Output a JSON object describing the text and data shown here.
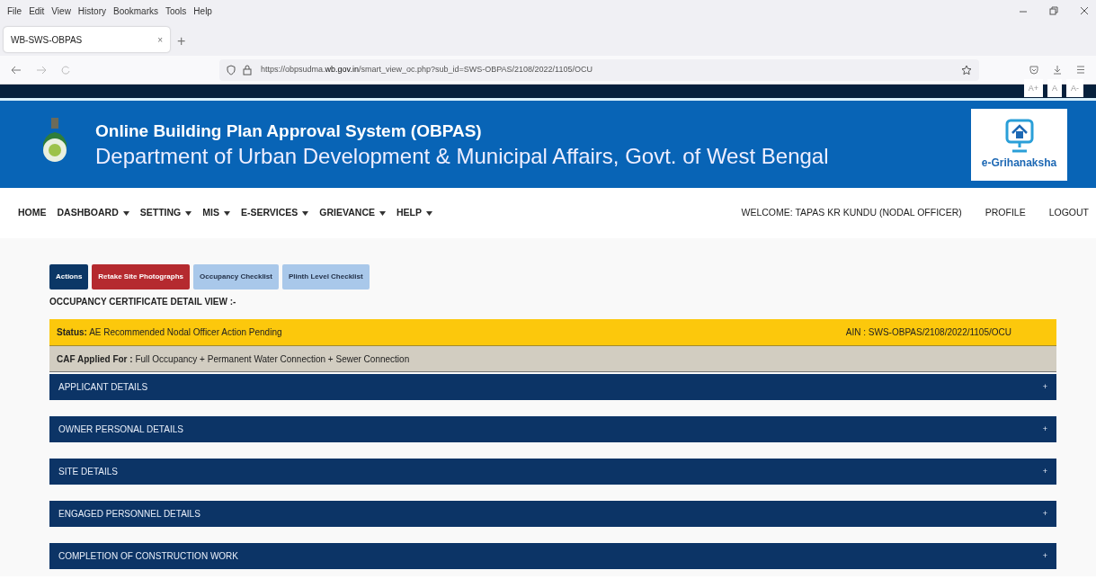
{
  "browser": {
    "menu": [
      "File",
      "Edit",
      "View",
      "History",
      "Bookmarks",
      "Tools",
      "Help"
    ],
    "tab": {
      "title": "WB-SWS-OBPAS",
      "close": "×",
      "new_tab": "+"
    },
    "url": "https://obpsudma.**wb.gov.in**/smart_view_oc.php?sub_id=SWS-OBPAS/2108/2022/1105/OCU"
  },
  "font_size_buttons": [
    "A+",
    "A",
    "A-"
  ],
  "header": {
    "title": "Online Building Plan Approval System (OBPAS)",
    "subtitle": "Department of Urban Development & Municipal Affairs, Govt. of West Bengal",
    "logo_text": "e-Grihanaksha"
  },
  "nav": {
    "items": [
      {
        "label": "HOME",
        "dropdown": false
      },
      {
        "label": "DASHBOARD",
        "dropdown": true
      },
      {
        "label": "SETTING",
        "dropdown": true
      },
      {
        "label": "MIS",
        "dropdown": true
      },
      {
        "label": "E-SERVICES",
        "dropdown": true
      },
      {
        "label": "GRIEVANCE",
        "dropdown": true
      },
      {
        "label": "HELP",
        "dropdown": true
      }
    ],
    "welcome": "WELCOME: TAPAS KR KUNDU (NODAL OFFICER)",
    "links": [
      "PROFILE",
      "LOGOUT"
    ]
  },
  "action_buttons": [
    {
      "label": "Actions",
      "kind": "primary"
    },
    {
      "label": "Retake Site Photographs",
      "kind": "danger"
    },
    {
      "label": "Occupancy Checklist",
      "kind": "light"
    },
    {
      "label": "Plinth Level Checklist",
      "kind": "light"
    }
  ],
  "page_title": "OCCUPANCY CERTIFICATE DETAIL VIEW :-",
  "status": {
    "text": "**Status:** AE Recommended Nodal Officer Action Pending",
    "ain": "AIN : SWS-OBPAS/2108/2022/1105/OCU"
  },
  "caf": "**CAF Applied For :** Full Occupancy + Permanent Water Connection + Sewer Connection",
  "sections": [
    {
      "title": "APPLICANT DETAILS",
      "toggle": "+"
    },
    {
      "title": "OWNER PERSONAL DETAILS",
      "toggle": "+"
    },
    {
      "title": "SITE DETAILS",
      "toggle": "+"
    },
    {
      "title": "ENGAGED PERSONNEL DETAILS",
      "toggle": "+"
    },
    {
      "title": "COMPLETION OF CONSTRUCTION WORK",
      "toggle": "+"
    }
  ]
}
